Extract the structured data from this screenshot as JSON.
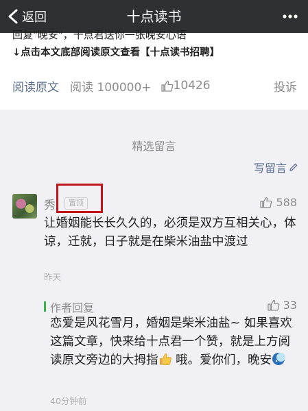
{
  "nav": {
    "back_label": "返回",
    "title": "十点读书"
  },
  "article": {
    "clipped_line": "回复\"晚安\"，十点君送你一张晚安心语",
    "notice": "↓点击本文底部阅读原文查看【十点读书招聘】",
    "read_original": "阅读原文",
    "reads": "阅读 100000+",
    "likes": "10426",
    "report": "投诉"
  },
  "comments": {
    "section_title": "精选留言",
    "write_label": "写留言",
    "items": [
      {
        "name": "秀",
        "badge": "置顶",
        "likes": "588",
        "text": "让婚姻能长长久久的，必须是双方互相关心，体谅，迁就，日子就是在柴米油盐中渡过",
        "time": "昨天",
        "reply": {
          "label": "作者回复",
          "likes": "33",
          "text_before": "恋爱是风花雪月，婚姻是柴米油盐~ 如果喜欢这篇文章，快来给十点君一个赞，就是上方阅读原文旁边的大拇指",
          "text_after": " 哦。爱你们，晚安",
          "time": "40分钟前"
        }
      }
    ]
  },
  "icons": {
    "back": "chevron-left-icon",
    "more": "more-dots-icon",
    "like": "thumbs-up-icon",
    "write": "pencil-icon",
    "emoji_thumb": "thumbs-up-emoji",
    "emoji_moon": "crescent-moon-emoji"
  },
  "colors": {
    "navbar": "#2f3034",
    "link": "#5a6d8f",
    "muted": "#8c8c8c",
    "reply_accent": "#3bb34a",
    "highlight": "#c0141b"
  }
}
